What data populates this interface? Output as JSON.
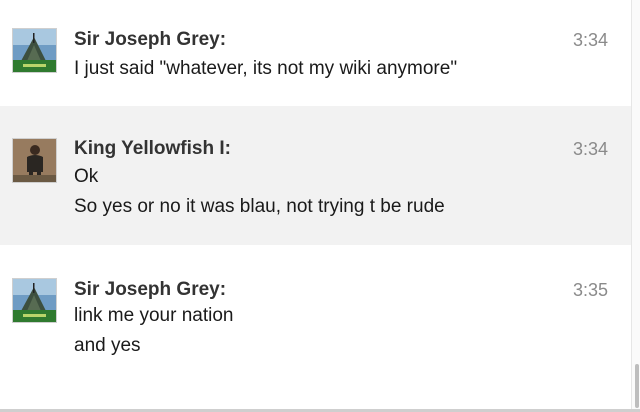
{
  "messages": [
    {
      "author": "Sir Joseph Grey:",
      "time": "3:34",
      "avatar_icon": "castle-flag-avatar",
      "lines": [
        "I just said \"whatever, its not my wiki anymore\""
      ]
    },
    {
      "author": "King Yellowfish I:",
      "time": "3:34",
      "avatar_icon": "person-photo-avatar",
      "lines": [
        "Ok",
        "So yes or no it was blau, not trying t be rude"
      ]
    },
    {
      "author": "Sir Joseph Grey:",
      "time": "3:35",
      "avatar_icon": "castle-flag-avatar",
      "lines": [
        "link me your nation",
        "and yes"
      ]
    }
  ],
  "colors": {
    "alt_row_bg": "#f2f2f2",
    "author_text": "#333333",
    "time_text": "#8a8a8a"
  }
}
